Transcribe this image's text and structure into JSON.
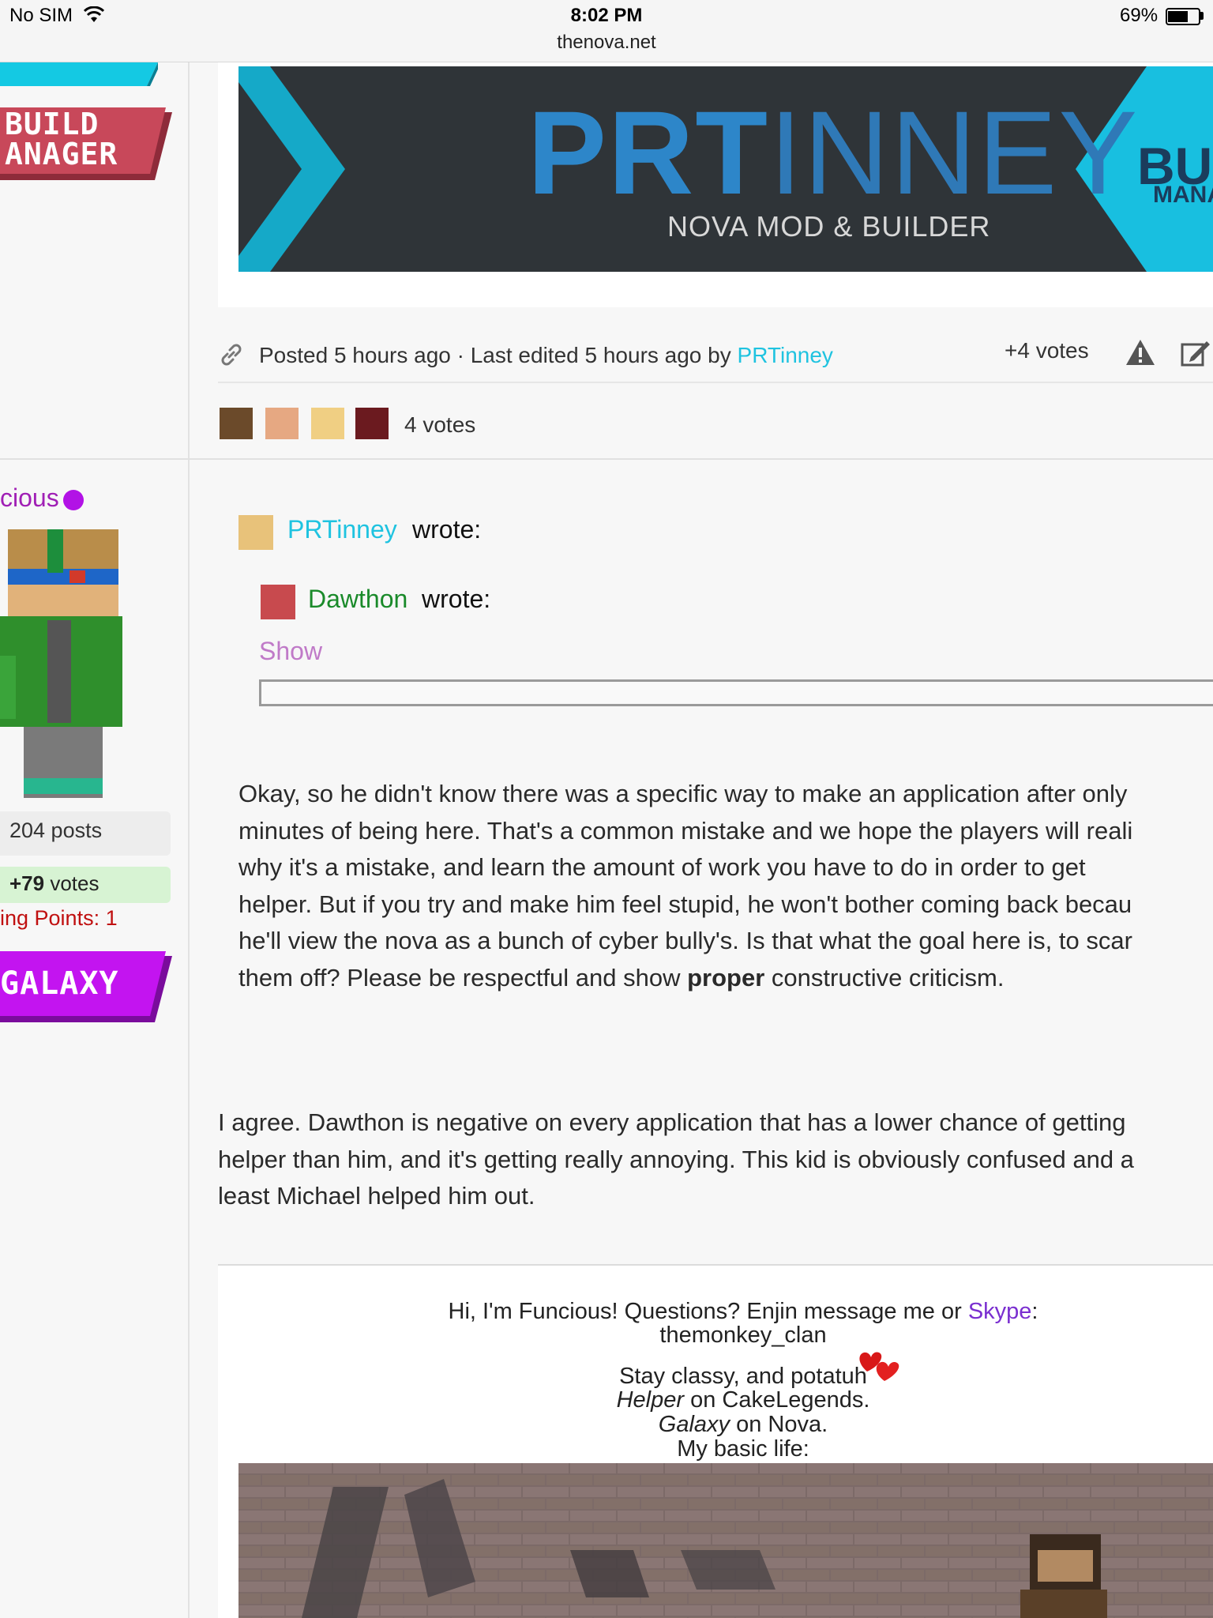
{
  "status_bar": {
    "carrier": "No SIM",
    "time": "8:02 PM",
    "url": "thenova.net",
    "battery": "69%",
    "battery_level": 0.69
  },
  "sidebar": {
    "build_badge_line1": "BUILD",
    "build_badge_line2": "ANAGER",
    "username": "cious",
    "posts": "204 posts",
    "votes_value": "+79",
    "votes_label": "votes",
    "ranking": "ing Points: 1",
    "galaxy_badge": "GALAXY"
  },
  "banner": {
    "title_bold": "PRT",
    "title_thin": "INNEY",
    "subtitle": "NOVA MOD & BUILDER",
    "side_text1": "BU",
    "side_text2": "MANA"
  },
  "post_meta": {
    "posted": "Posted 5 hours ago · Last edited 5 hours ago by",
    "editor": "PRTinney",
    "votes": "+4  votes",
    "voter_count": "4 votes"
  },
  "quote": {
    "user1": "PRTinney",
    "wrote1": "wrote:",
    "user2": "Dawthon",
    "wrote2": "wrote:",
    "show": "Show"
  },
  "quoted_paragraph": {
    "l1": "Okay, so he didn't know there was a specific way to make an application after only",
    "l2": "minutes of being here. That's a common mistake and we hope the players will reali",
    "l3": "why it's a mistake, and learn the amount of work you have to do in order to get",
    "l4": "helper. But if you try and make him feel stupid, he won't bother coming back becau",
    "l5": "he'll view the nova as a bunch of cyber bully's. Is that what the goal here is, to scar",
    "l6_a": "them off? Please be respectful and show ",
    "l6_bold": "proper",
    "l6_b": " constructive criticism."
  },
  "reply_paragraph": {
    "l1": "I agree. Dawthon is negative on every application that has a lower chance of getting",
    "l2": "helper than him, and it's getting really annoying. This kid is obviously confused and a",
    "l3": "least Michael helped him out."
  },
  "signature": {
    "line1_a": "Hi, I'm Funcious! Questions? Enjin message me or ",
    "line1_link": "Skype",
    "line1_b": ":",
    "line2": "themonkey_clan",
    "line3": "Stay classy, and potatuh",
    "line4_em": "Helper",
    "line4_rest": " on CakeLegends.",
    "line5_em": "Galaxy",
    "line5_rest": " on Nova.",
    "line6": "My basic life:"
  },
  "colors": {
    "accent_cyan": "#1fc3e0",
    "quote_green": "#1a8a2a",
    "username_purple": "#a01fb5",
    "galaxy_purple": "#b212e6",
    "build_red": "#c8485a"
  }
}
